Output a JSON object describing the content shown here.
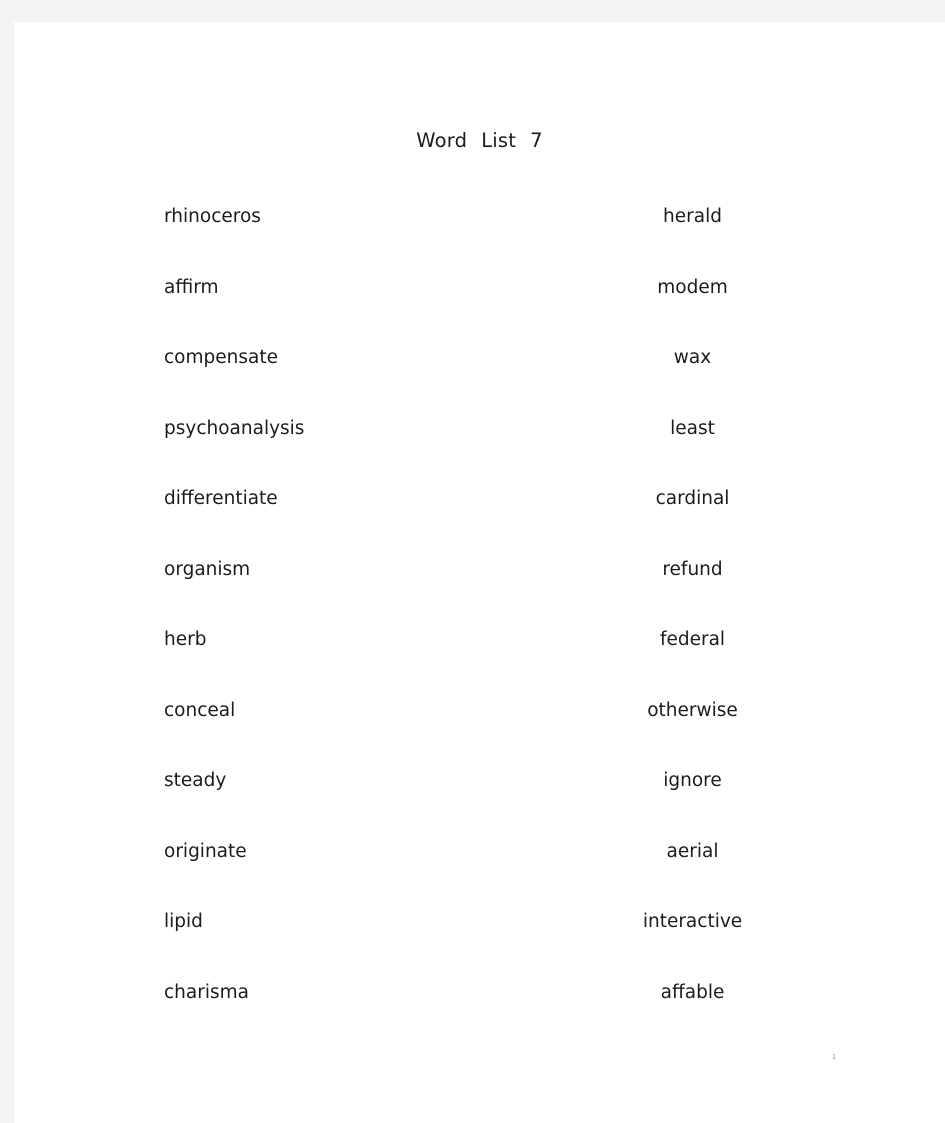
{
  "document": {
    "title_word1": "Word",
    "title_word2": "List",
    "title_number": "7",
    "page_number": "1"
  },
  "word_list": {
    "rows": [
      {
        "left": "rhinoceros",
        "right": "herald"
      },
      {
        "left": "affirm",
        "right": "modem"
      },
      {
        "left": "compensate",
        "right": "wax"
      },
      {
        "left": "psychoanalysis",
        "right": "least"
      },
      {
        "left": "differentiate",
        "right": "cardinal"
      },
      {
        "left": "organism",
        "right": "refund"
      },
      {
        "left": "herb",
        "right": "federal"
      },
      {
        "left": "conceal",
        "right": "otherwise"
      },
      {
        "left": "steady",
        "right": "ignore"
      },
      {
        "left": "originate",
        "right": "aerial"
      },
      {
        "left": "lipid",
        "right": "interactive"
      },
      {
        "left": "charisma",
        "right": "affable"
      }
    ]
  },
  "colors": {
    "page_background": "#ffffff",
    "canvas_background": "#f4f4f5",
    "text": "#1b1b1b",
    "page_number_text": "#9a9aa2"
  }
}
